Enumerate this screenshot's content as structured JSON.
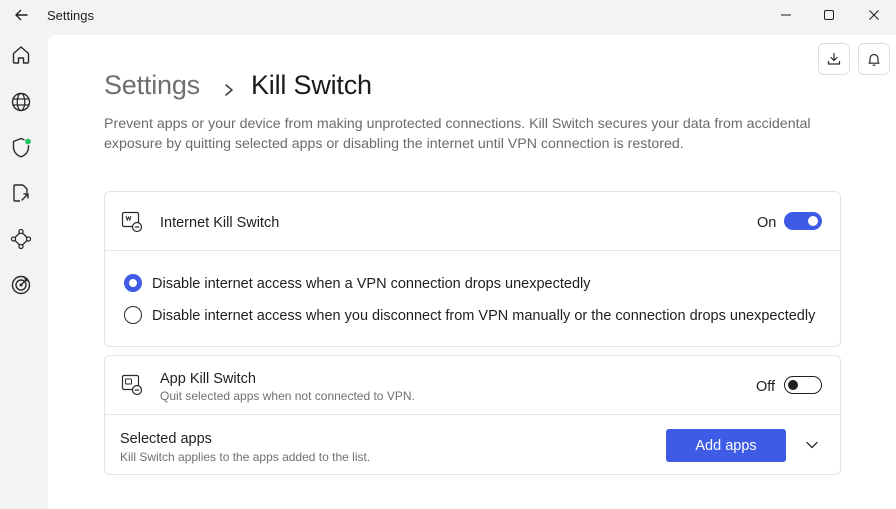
{
  "window": {
    "title": "Settings"
  },
  "breadcrumb": {
    "parent": "Settings",
    "current": "Kill Switch"
  },
  "description": "Prevent apps or your device from making unprotected connections. Kill Switch secures your data from accidental exposure by quitting selected apps or disabling the internet until VPN connection is restored.",
  "internet_kill_switch": {
    "title": "Internet Kill Switch",
    "state_label": "On",
    "enabled": true,
    "options": [
      {
        "label": "Disable internet access when a VPN connection drops unexpectedly",
        "selected": true
      },
      {
        "label": "Disable internet access when you disconnect from VPN manually or the connection drops unexpectedly",
        "selected": false
      }
    ]
  },
  "app_kill_switch": {
    "title": "App Kill Switch",
    "subtitle": "Quit selected apps when not connected to VPN.",
    "state_label": "Off",
    "enabled": false,
    "selected_apps": {
      "title": "Selected apps",
      "subtitle": "Kill Switch applies to the apps added to the list.",
      "button_label": "Add apps"
    }
  },
  "icons": {
    "sidebar": [
      "home-icon",
      "globe-icon",
      "shield-icon",
      "split-tunnel-icon",
      "meshnet-icon",
      "target-icon"
    ],
    "top": [
      "download-icon",
      "bell-icon"
    ]
  },
  "colors": {
    "accent": "#3e5be6",
    "status_dot": "#22c55e"
  }
}
